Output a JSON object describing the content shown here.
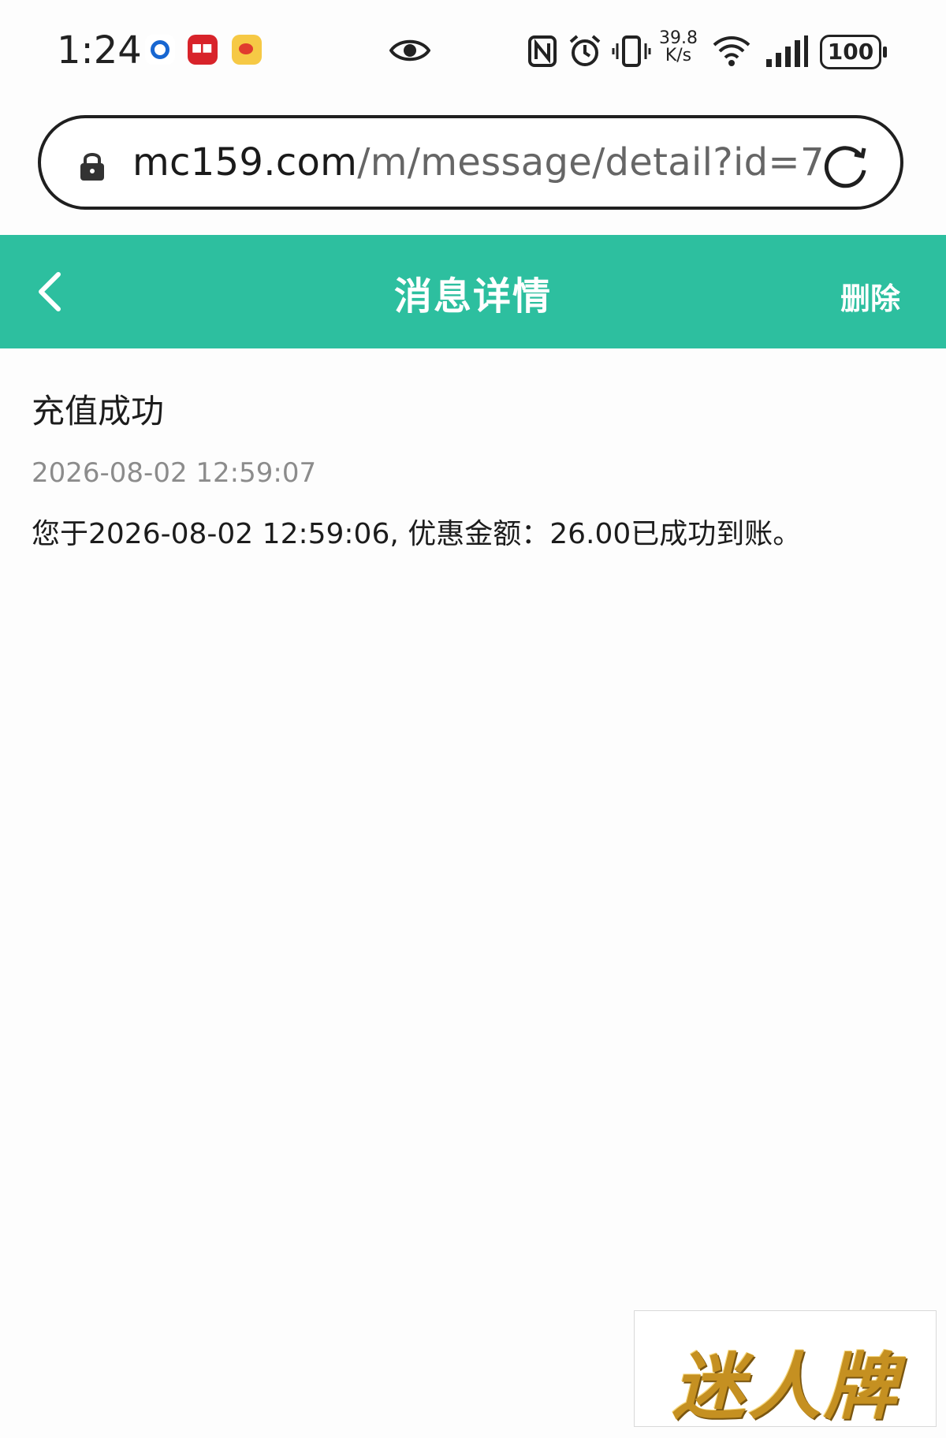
{
  "status_bar": {
    "time": "1:24",
    "speed_value": "39.8",
    "speed_unit": "K/s",
    "battery": "100",
    "icons": [
      "app-blue-icon",
      "app-red-icon",
      "weibo-icon",
      "eye-icon",
      "nfc-icon",
      "alarm-icon",
      "vibrate-icon",
      "wifi-icon",
      "signal-icon",
      "battery-icon"
    ]
  },
  "browser": {
    "url_domain": "mc159.com",
    "url_path": "/m/message/detail?id=7"
  },
  "header": {
    "title": "消息详情",
    "delete_label": "删除",
    "background_color": "#2dbf9f"
  },
  "message": {
    "title": "充值成功",
    "time": "2026-08-02 12:59:07",
    "body": "您于2026-08-02 12:59:06, 优惠金额：26.00已成功到账。"
  },
  "watermark": {
    "text": "迷人牌"
  }
}
